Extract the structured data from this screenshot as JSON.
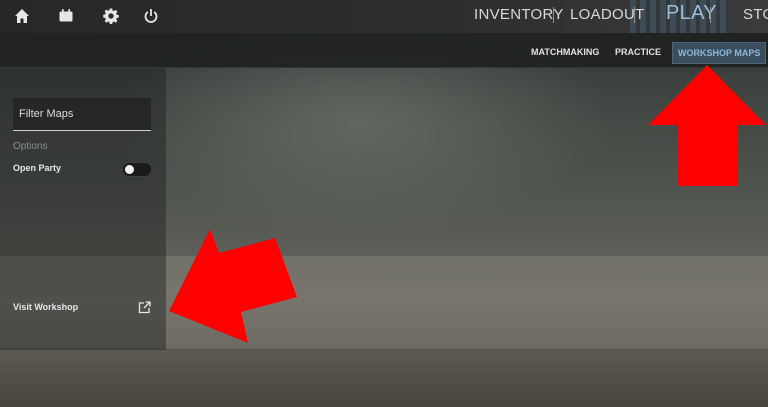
{
  "topnav": {
    "items": [
      "INVENTORY",
      "LOADOUT",
      "PLAY",
      "STO"
    ],
    "icons": [
      "home-icon",
      "tv-icon",
      "gear-icon",
      "power-icon"
    ]
  },
  "subnav": {
    "items": [
      "MATCHMAKING",
      "PRACTICE",
      "WORKSHOP MAPS"
    ],
    "active": "WORKSHOP MAPS"
  },
  "sidebar": {
    "filter_placeholder": "Filter Maps",
    "options_label": "Options",
    "open_party_label": "Open Party",
    "open_party_enabled": false,
    "visit_workshop_label": "Visit Workshop"
  },
  "colors": {
    "accent": "#8fb7d8",
    "annotation": "#ff0000"
  }
}
